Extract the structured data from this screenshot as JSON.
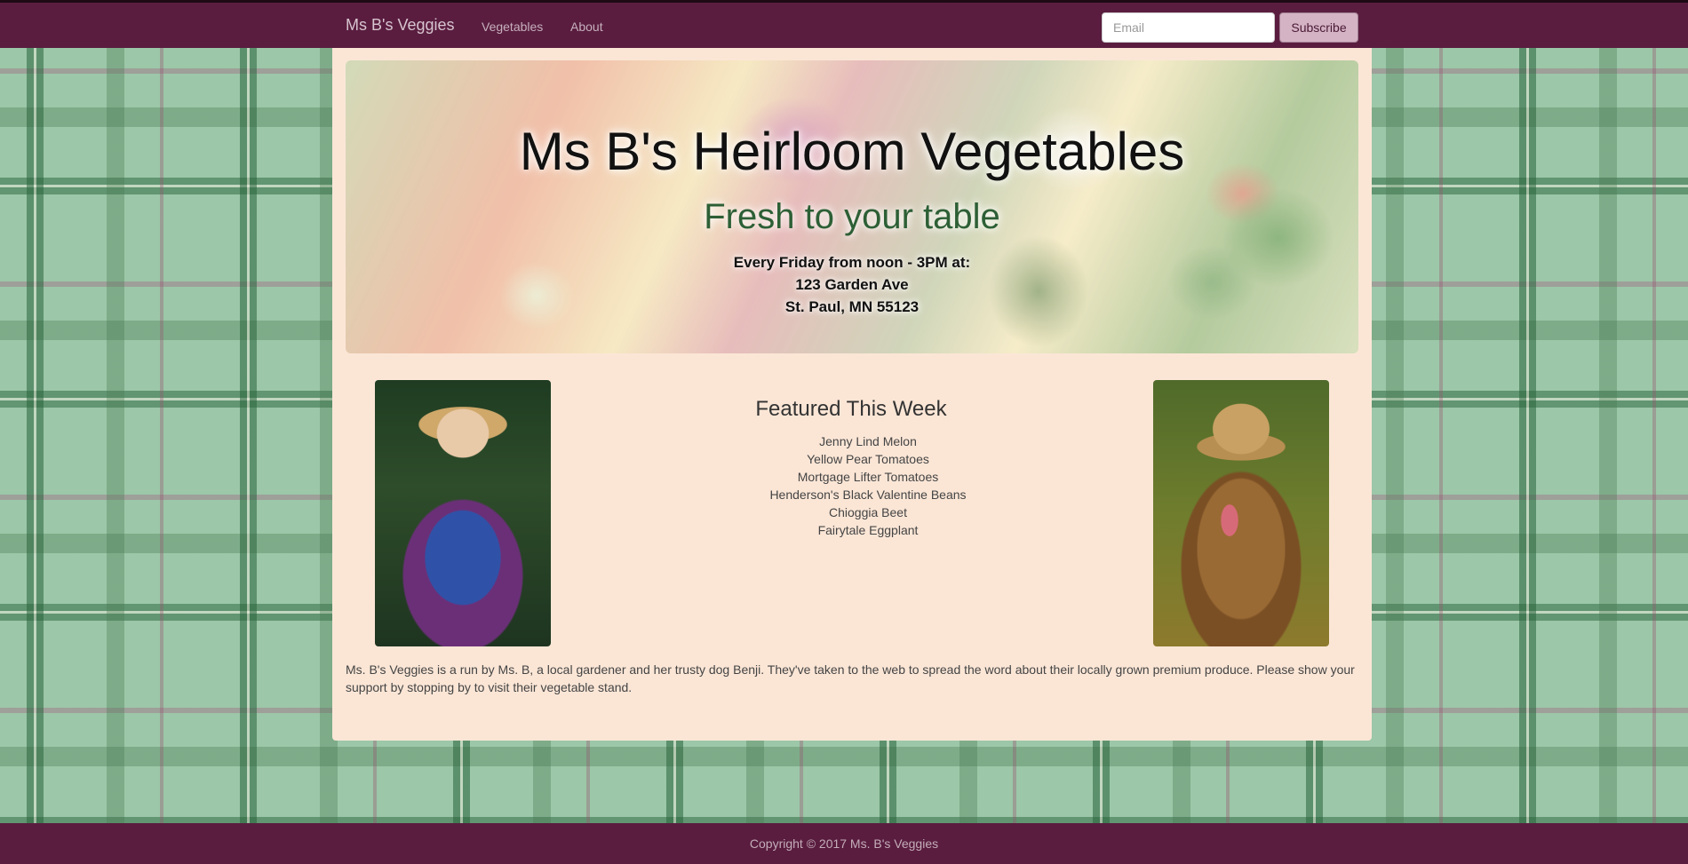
{
  "navbar": {
    "brand": "Ms B's Veggies",
    "links": [
      "Vegetables",
      "About"
    ],
    "email_placeholder": "Email",
    "subscribe_label": "Subscribe"
  },
  "hero": {
    "title": "Ms B's Heirloom Vegetables",
    "subtitle": "Fresh to your table",
    "schedule": "Every Friday from noon - 3PM at:",
    "address_line1": "123 Garden Ave",
    "address_line2": "St. Paul, MN 55123"
  },
  "featured": {
    "title": "Featured This Week",
    "items": [
      "Jenny Lind Melon",
      "Yellow Pear Tomatoes",
      "Mortgage Lifter Tomatoes",
      "Henderson's Black Valentine Beans",
      "Chioggia Beet",
      "Fairytale Eggplant"
    ]
  },
  "about": "Ms. B's Veggies is a run by Ms. B, a local gardener and her trusty dog Benji. They've taken to the web to spread the word about their locally grown premium produce. Please show your support by stopping by to visit their vegetable stand.",
  "footer": "Copyright © 2017 Ms. B's Veggies",
  "colors": {
    "navbar": "#5a1d3f",
    "content_background": "#fbe6d6",
    "subtitle_green": "#2d5f35",
    "subscribe_button": "#d4b3c4"
  }
}
